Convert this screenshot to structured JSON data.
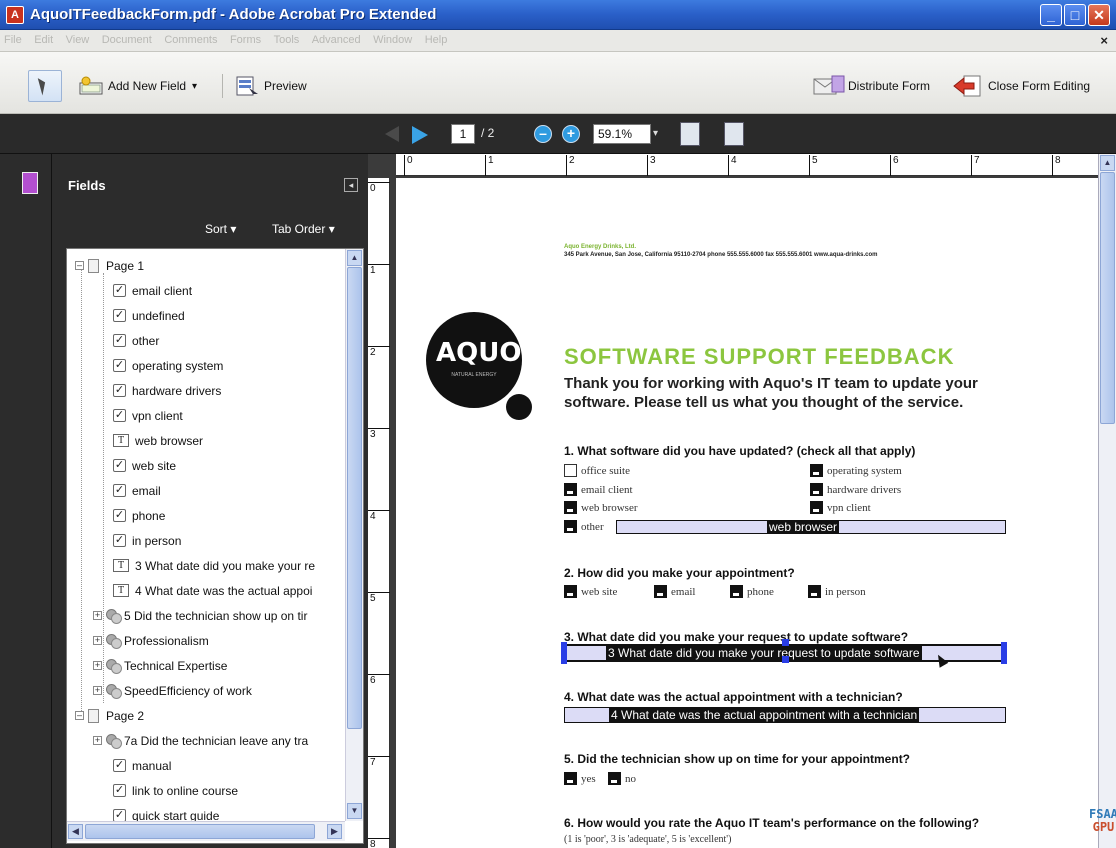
{
  "window": {
    "title": "AquoITFeedbackForm.pdf - Adobe Acrobat Pro Extended",
    "icon": "acrobat-icon"
  },
  "menu": [
    "File",
    "Edit",
    "View",
    "Document",
    "Comments",
    "Forms",
    "Tools",
    "Advanced",
    "Window",
    "Help"
  ],
  "menu_close": "×",
  "toolbar": {
    "add_new_field": "Add New Field",
    "add_new_field_arrow": "▾",
    "preview": "Preview",
    "distribute_form": "Distribute Form",
    "close_form_editing": "Close Form Editing"
  },
  "nav": {
    "current_page": "1",
    "page_total": "/ 2",
    "zoom_out": "–",
    "zoom_in": "+",
    "zoom": "59.1%",
    "zoom_arrow": "▾"
  },
  "panel": {
    "title": "Fields",
    "collapse": "◂",
    "sort": "Sort ▾",
    "tab_order": "Tab Order ▾"
  },
  "tree": {
    "page1": "Page 1",
    "page2": "Page 2",
    "items": [
      {
        "label": "email client",
        "type": "check"
      },
      {
        "label": "undefined",
        "type": "check"
      },
      {
        "label": "other",
        "type": "check"
      },
      {
        "label": "operating system",
        "type": "check"
      },
      {
        "label": "hardware drivers",
        "type": "check"
      },
      {
        "label": "vpn client",
        "type": "check"
      },
      {
        "label": "web browser",
        "type": "text"
      },
      {
        "label": "web site",
        "type": "check"
      },
      {
        "label": "email",
        "type": "check"
      },
      {
        "label": "phone",
        "type": "check"
      },
      {
        "label": "in person",
        "type": "check"
      },
      {
        "label": "3 What date did you make your re",
        "type": "text"
      },
      {
        "label": "4 What date was the actual appoi",
        "type": "text"
      },
      {
        "label": "5 Did the technician show up on tir",
        "type": "radio"
      },
      {
        "label": "Professionalism",
        "type": "radio"
      },
      {
        "label": "Technical Expertise",
        "type": "radio"
      },
      {
        "label": "SpeedEfficiency of work",
        "type": "radio"
      }
    ],
    "page2_items": [
      {
        "label": "7a Did the technician leave any tra",
        "type": "radio"
      },
      {
        "label": "manual",
        "type": "check"
      },
      {
        "label": "link to online course",
        "type": "check"
      },
      {
        "label": "quick start guide",
        "type": "check"
      }
    ]
  },
  "ruler": {
    "top": [
      "0",
      "1",
      "2",
      "3",
      "4",
      "5",
      "6",
      "7",
      "8"
    ],
    "left": [
      "0",
      "1",
      "2",
      "3",
      "4",
      "5",
      "6",
      "7",
      "8"
    ]
  },
  "doc": {
    "company_name": "Aquo Energy Drinks, Ltd.",
    "company_address": "345 Park Avenue, San Jose, California 95110-2704  phone 555.555.6000  fax 555.555.6001  www.aqua-drinks.com",
    "logo_text": "AQUO",
    "logo_sub": "NATURAL ENERGY",
    "title": "SOFTWARE SUPPORT FEEDBACK",
    "subtitle": "Thank you for working with Aquo's IT team to update your software. Please tell us what you thought of the service.",
    "q1": "1. What software did you have updated? (check all that apply)",
    "q1_options": {
      "office_suite": "office suite",
      "email_client": "email client",
      "web_browser": "web browser",
      "other": "other",
      "operating_system": "operating system",
      "hardware_drivers": "hardware drivers",
      "vpn_client": "vpn client"
    },
    "q1_other_field": "web browser",
    "q2": "2. How did you make your appointment?",
    "q2_options": [
      "web site",
      "email",
      "phone",
      "in person"
    ],
    "q3": "3. What date did you make your request to update software?",
    "q3_field": "3 What date did you make your request to update software",
    "q4": "4. What date was the actual appointment with a technician?",
    "q4_field": "4 What date was the actual appointment with a technician",
    "q5": "5. Did the technician show up on time for your appointment?",
    "q5_options": [
      "yes",
      "no"
    ],
    "q6": "6. How would you rate the Aquo IT team's performance on the following?",
    "q6_note": "(1 is 'poor', 3 is 'adequate', 5 is 'excellent')"
  },
  "overlay": {
    "line1": "FSAA",
    "line2": "GPU"
  },
  "colors": {
    "title_green": "#8cc63f",
    "titlebar_blue": "#2a5fc8",
    "handle_blue": "#2a3ee6"
  }
}
